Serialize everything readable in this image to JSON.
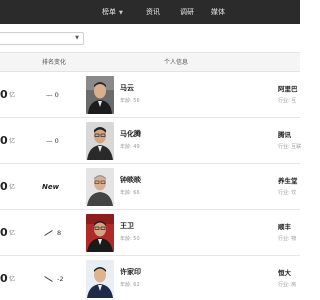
{
  "nav": {
    "rankings_label": "榜单",
    "info_label": "资讯",
    "research_label": "调研",
    "media_label": "媒体"
  },
  "filter": {
    "select_value": ""
  },
  "table": {
    "headers": {
      "rank_change": "排名变化",
      "personal_info": "个人信息"
    },
    "rows": [
      {
        "worth": "0",
        "unit": "亿",
        "change": "— 0",
        "change_type": "same",
        "name": "马云",
        "age": "年龄: 56",
        "company": "阿里巴",
        "industry": "行业: 互"
      },
      {
        "worth": "0",
        "unit": "亿",
        "change": "— 0",
        "change_type": "same",
        "name": "马化腾",
        "age": "年龄: 49",
        "company": "腾讯",
        "industry": "行业: 互联"
      },
      {
        "worth": "0",
        "unit": "亿",
        "change": "New",
        "change_type": "new",
        "name": "钟睒睒",
        "age": "年龄: 66",
        "company": "养生堂",
        "industry": "行业: 饮"
      },
      {
        "worth": "0",
        "unit": "亿",
        "change": "8",
        "change_type": "up",
        "name": "王卫",
        "age": "年龄: 50",
        "company": "顺丰",
        "industry": "行业: 物"
      },
      {
        "worth": "0",
        "unit": "亿",
        "change": "-2",
        "change_type": "down",
        "name": "许家印",
        "age": "年龄: 62",
        "company": "恒大",
        "industry": "行业: 房"
      }
    ]
  },
  "colors": {
    "topbar": "#2b2b2b",
    "header_bg": "#f5f5f5",
    "border": "#e6e6e6"
  }
}
